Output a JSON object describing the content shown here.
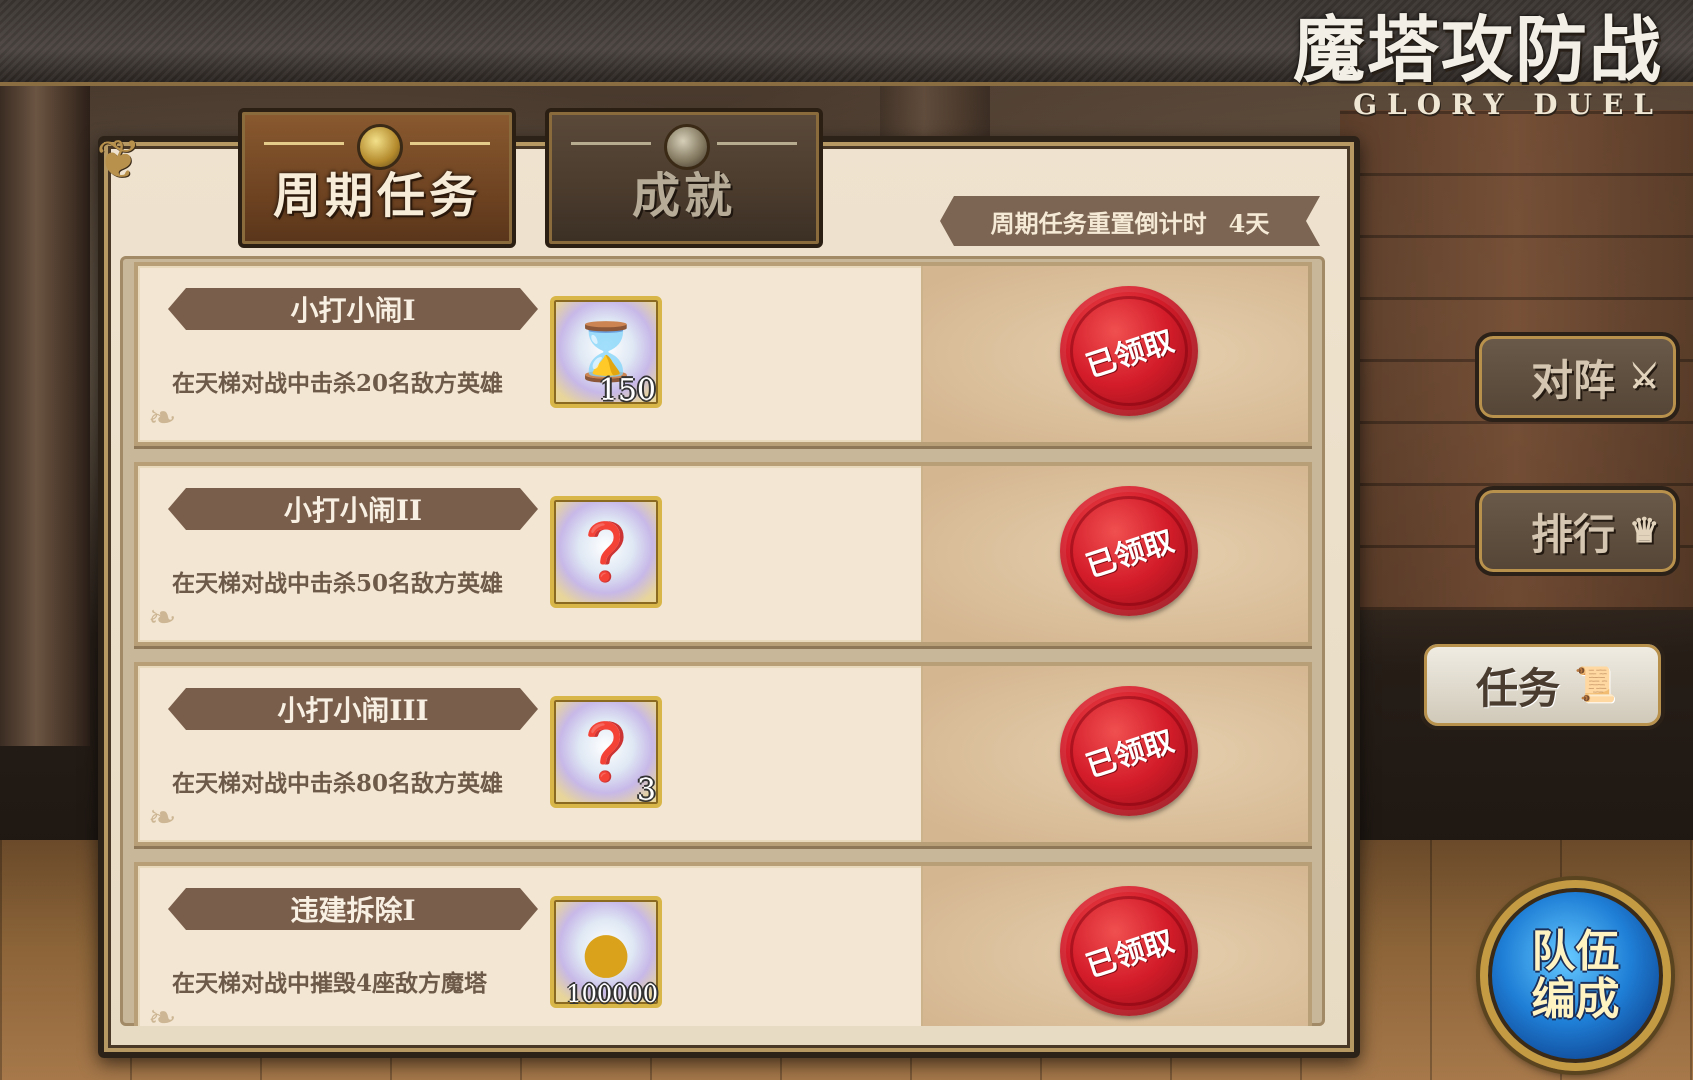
{
  "title": {
    "cn": "魔塔攻防战",
    "en": "GLORY DUEL"
  },
  "tabs": [
    {
      "label": "周期任务",
      "active": true
    },
    {
      "label": "成就",
      "active": false
    }
  ],
  "countdown": {
    "label": "周期任务重置倒计时",
    "value": "4天"
  },
  "quests": [
    {
      "name": "小打小闹I",
      "desc": "在天梯对战中击杀20名敌方英雄",
      "reward_icon": "hourglass-icon",
      "reward_glyph": "⌛",
      "qty": "150",
      "status": "已领取"
    },
    {
      "name": "小打小闹II",
      "desc": "在天梯对战中击杀50名敌方英雄",
      "reward_icon": "mystery-stone-icon",
      "reward_glyph": "❓",
      "qty": "",
      "status": "已领取"
    },
    {
      "name": "小打小闹III",
      "desc": "在天梯对战中击杀80名敌方英雄",
      "reward_icon": "mystery-stone-icon",
      "reward_glyph": "❓",
      "qty": "3",
      "status": "已领取"
    },
    {
      "name": "违建拆除I",
      "desc": "在天梯对战中摧毁4座敌方魔塔",
      "reward_icon": "gold-coin-icon",
      "reward_glyph": "●",
      "qty": "100000",
      "status": "已领取"
    }
  ],
  "side_nav": [
    {
      "label": "对阵",
      "icon": "sword-icon",
      "glyph": "⚔",
      "active": false
    },
    {
      "label": "排行",
      "icon": "crown-icon",
      "glyph": "♛",
      "active": false
    },
    {
      "label": "任务",
      "icon": "scroll-icon",
      "glyph": "📜",
      "active": true
    }
  ],
  "team_button": {
    "line1": "队伍",
    "line2": "编成"
  },
  "colors": {
    "seal_red": "#d41c2a",
    "panel_bg": "#efe3cf",
    "active_tab": "#7a4b27"
  }
}
